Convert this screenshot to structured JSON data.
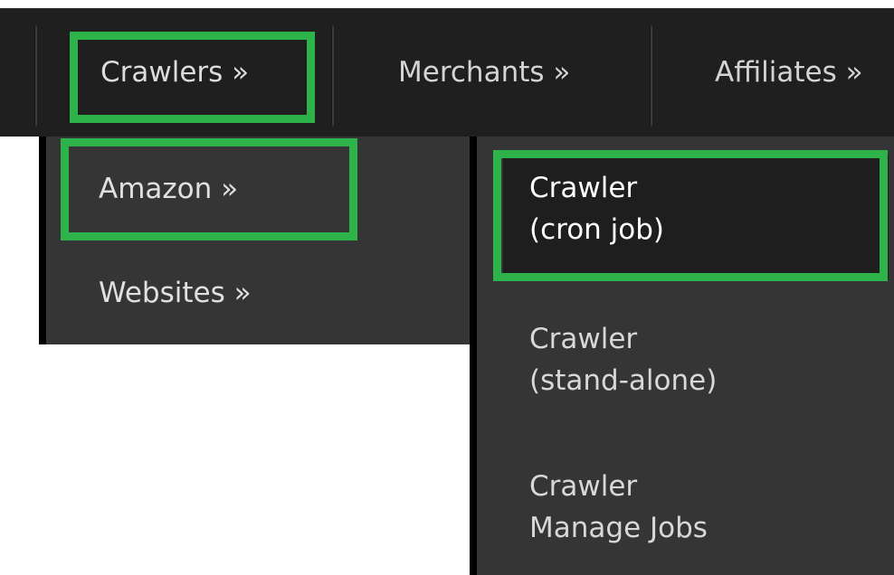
{
  "nav": {
    "items": [
      {
        "label": "Crawlers »",
        "active": true
      },
      {
        "label": "Merchants »",
        "active": false
      },
      {
        "label": "Affiliates »",
        "active": false
      }
    ]
  },
  "submenu_level1": {
    "items": [
      {
        "label": "Amazon »",
        "active": true
      },
      {
        "label": "Websites »",
        "active": false
      }
    ]
  },
  "submenu_level2": {
    "items": [
      {
        "line1": "Crawler",
        "line2": "(cron job)",
        "active": true
      },
      {
        "line1": "Crawler",
        "line2": "(stand-alone)",
        "active": false
      },
      {
        "line1": "Crawler",
        "line2": "Manage Jobs",
        "active": false
      }
    ]
  },
  "colors": {
    "topbar_bg": "#1f1f1f",
    "menu_bg": "#353535",
    "active_item_bg": "#1e1e1e",
    "highlight_green": "#2db34a",
    "menu_border": "#000000"
  }
}
